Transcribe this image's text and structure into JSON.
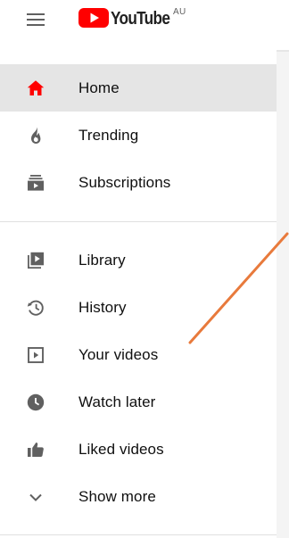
{
  "header": {
    "menu_icon": "hamburger-menu-icon",
    "logo_text": "YouTube",
    "logo_region": "AU",
    "logo_color": "#ff0000"
  },
  "nav": {
    "primary": [
      {
        "label": "Home",
        "icon": "home-icon",
        "active": true
      },
      {
        "label": "Trending",
        "icon": "flame-icon",
        "active": false
      },
      {
        "label": "Subscriptions",
        "icon": "subscriptions-icon",
        "active": false
      }
    ],
    "secondary": [
      {
        "label": "Library",
        "icon": "library-icon"
      },
      {
        "label": "History",
        "icon": "history-icon"
      },
      {
        "label": "Your videos",
        "icon": "play-square-icon"
      },
      {
        "label": "Watch later",
        "icon": "clock-icon"
      },
      {
        "label": "Liked videos",
        "icon": "thumbs-up-icon"
      },
      {
        "label": "Show more",
        "icon": "chevron-down-icon"
      }
    ]
  },
  "colors": {
    "active_icon": "#ff0000",
    "icon": "#606060",
    "active_bg": "#e5e5e5",
    "annotation": "#e87a3c"
  }
}
